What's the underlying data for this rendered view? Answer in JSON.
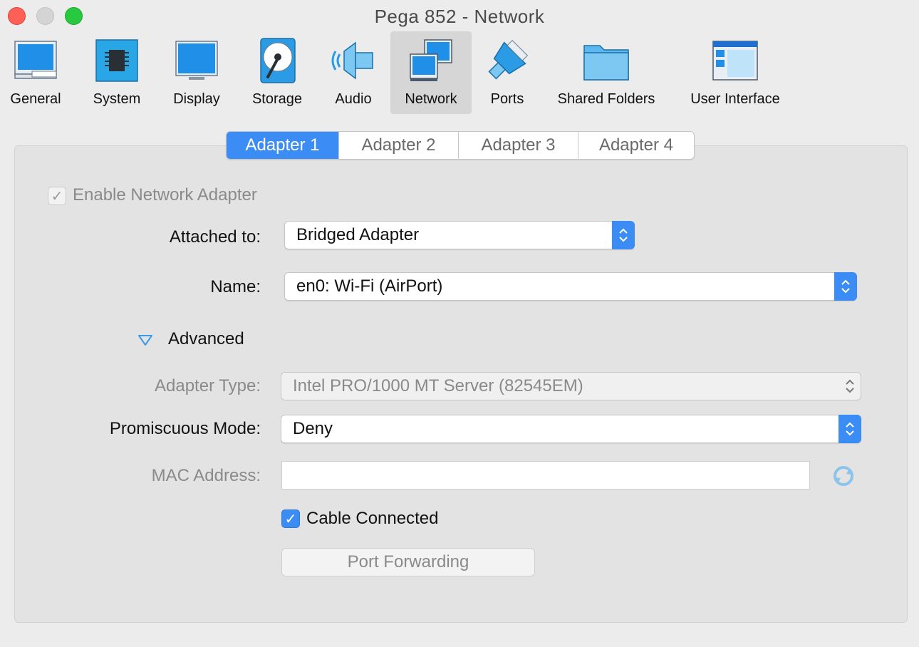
{
  "window": {
    "title": "Pega 852 - Network"
  },
  "toolbar": {
    "items": [
      {
        "label": "General",
        "icon": "general-icon"
      },
      {
        "label": "System",
        "icon": "system-icon"
      },
      {
        "label": "Display",
        "icon": "display-icon"
      },
      {
        "label": "Storage",
        "icon": "storage-icon"
      },
      {
        "label": "Audio",
        "icon": "audio-icon"
      },
      {
        "label": "Network",
        "icon": "network-icon",
        "selected": true
      },
      {
        "label": "Ports",
        "icon": "ports-icon"
      },
      {
        "label": "Shared Folders",
        "icon": "shared-folders-icon"
      },
      {
        "label": "User Interface",
        "icon": "user-interface-icon"
      }
    ]
  },
  "tabs": [
    {
      "label": "Adapter 1",
      "active": true
    },
    {
      "label": "Adapter 2"
    },
    {
      "label": "Adapter 3"
    },
    {
      "label": "Adapter 4"
    }
  ],
  "form": {
    "enable_adapter": {
      "label": "Enable Network Adapter",
      "checked": true,
      "enabled": false
    },
    "attached_to": {
      "label": "Attached to:",
      "value": "Bridged Adapter"
    },
    "name": {
      "label": "Name:",
      "value": "en0: Wi-Fi (AirPort)"
    },
    "advanced": {
      "label": "Advanced",
      "expanded": true
    },
    "adapter_type": {
      "label": "Adapter Type:",
      "value": "Intel PRO/1000 MT Server (82545EM)",
      "enabled": false
    },
    "promiscuous_mode": {
      "label": "Promiscuous Mode:",
      "value": "Deny"
    },
    "mac_address": {
      "label": "MAC Address:",
      "value": "",
      "enabled": false
    },
    "cable_connected": {
      "label": "Cable Connected",
      "checked": true
    },
    "port_forwarding": {
      "label": "Port Forwarding",
      "enabled": false
    }
  },
  "colors": {
    "accent": "#3b8cf5",
    "close": "#fe5f57",
    "maximize": "#28c840",
    "panel": "#e3e3e3"
  }
}
